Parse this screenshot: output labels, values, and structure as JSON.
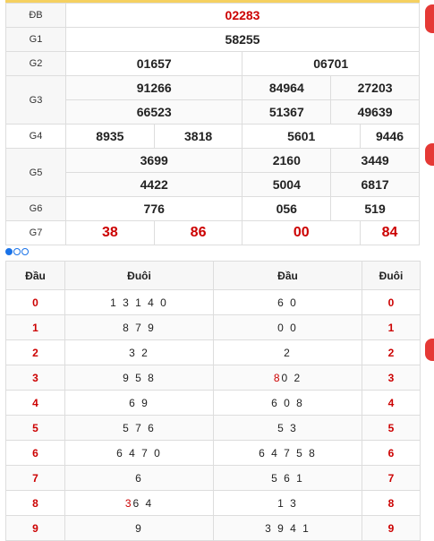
{
  "prizes": {
    "db": {
      "label": "ĐB",
      "value": "02283"
    },
    "g1": {
      "label": "G1",
      "value": "58255"
    },
    "g2": {
      "label": "G2",
      "values": [
        "01657",
        "06701"
      ]
    },
    "g3": {
      "label": "G3",
      "values": [
        "91266",
        "84964",
        "27203",
        "66523",
        "51367",
        "49639"
      ]
    },
    "g4": {
      "label": "G4",
      "values": [
        "8935",
        "3818",
        "5601",
        "9446"
      ]
    },
    "g5": {
      "label": "G5",
      "values": [
        "3699",
        "2160",
        "3449",
        "4422",
        "5004",
        "6817"
      ]
    },
    "g6": {
      "label": "G6",
      "values": [
        "776",
        "056",
        "519"
      ]
    },
    "g7": {
      "label": "G7",
      "values": [
        "38",
        "86",
        "00",
        "84"
      ]
    }
  },
  "loto": {
    "headers": [
      "Đầu",
      "Đuôi",
      "Đuôi",
      "Đầu"
    ],
    "left_heads": [
      "0",
      "1",
      "2",
      "3",
      "4",
      "5",
      "6",
      "7",
      "8",
      "9"
    ],
    "left_tails": [
      "1 3 1 4 0",
      "8 7 9",
      "3 2",
      "9 5 8",
      "6 9",
      "5 7 6",
      "6 4 7 0",
      "6",
      "3 6 4",
      "9"
    ],
    "right_tails": [
      "6 0",
      "0 0",
      "2",
      "8 0 2",
      "6 0 8",
      "5 3",
      "6 4 7 5 8",
      "5 6 1",
      "1 3",
      "3 9 4 1"
    ],
    "right_heads": [
      "0",
      "1",
      "2",
      "3",
      "4",
      "5",
      "6",
      "7",
      "8",
      "9"
    ],
    "left_tails_red_prefix": [
      "",
      "",
      "",
      "",
      "",
      "",
      "",
      "",
      "3",
      ""
    ],
    "left_tails_rest": [
      "1 3 1 4 0",
      "8 7 9",
      "3 2",
      "9 5 8",
      "6 9",
      "5 7 6",
      "6 4 7 0",
      "6",
      "6 4",
      "9"
    ],
    "right_tails_red_prefix": [
      "",
      "",
      "",
      "8",
      "",
      "",
      "",
      "",
      "",
      ""
    ],
    "right_tails_rest": [
      "6 0",
      "0 0",
      "2",
      "0 2",
      "6 0 8",
      "5 3",
      "6 4 7 5 8",
      "5 6 1",
      "1 3",
      "3 9 4 1"
    ]
  },
  "colors": {
    "accent_red": "#cc0000",
    "pager_blue": "#1a73e8"
  }
}
